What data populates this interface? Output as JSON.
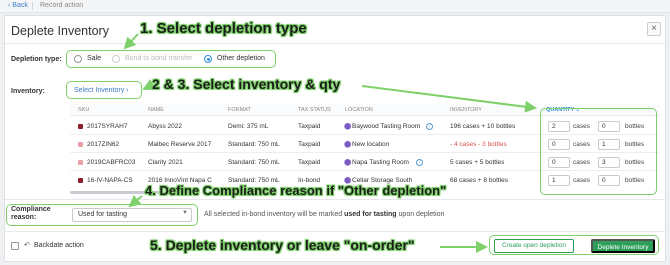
{
  "topbar": {
    "back_label": "‹ Back",
    "record_action": "Record action"
  },
  "page": {
    "title": "Deplete Inventory",
    "close_icon": "close-icon"
  },
  "depletion_type": {
    "label": "Depletion type:",
    "options": [
      "Sale",
      "Bond to bond transfer",
      "Other depletion"
    ],
    "selected": "Other depletion"
  },
  "inventory": {
    "label": "Inventory:",
    "select_link": "Select Inventory ›"
  },
  "table": {
    "headers": {
      "sku": "SKU",
      "name": "NAME",
      "format": "FORMAT",
      "tax_status": "TAX STATUS",
      "location": "LOCATION",
      "inventory": "INVENTORY",
      "quantity": "QUANTITY ⌄"
    },
    "rows": [
      {
        "sku": "2017SYRAH7",
        "name": "Abyss 2022",
        "format": "Demi: 375 mL",
        "tax": "Taxpaid",
        "location": "Baywood Tasting Room",
        "inventory": "196 cases + 10 bottles",
        "cases": "2",
        "bottles": "0",
        "color": "#8b1e2d"
      },
      {
        "sku": "2017ZIN62",
        "name": "Malbec Reserve 2017",
        "format": "Standard: 750 mL",
        "tax": "Taxpaid",
        "location": "New location",
        "inventory": "- 4 cases - 3 bottles",
        "cases": "0",
        "bottles": "1",
        "color": "#e8a0a8"
      },
      {
        "sku": "2019CABFRC03",
        "name": "Clarity 2021",
        "format": "Standard: 750 mL",
        "tax": "Taxpaid",
        "location": "Napa Tasting Room",
        "inventory": "5 cases + 5 bottles",
        "cases": "0",
        "bottles": "3",
        "color": "#e8a0a8"
      },
      {
        "sku": "16-IV-NAPA-CS",
        "name": "2016 InnoVint Napa C",
        "format": "Standard: 750 mL",
        "tax": "In-bond",
        "location": "Cellar Storage South",
        "inventory": "68 cases + 8 bottles",
        "cases": "1",
        "bottles": "0",
        "color": "#8b1e2d"
      }
    ],
    "unit_cases": "cases",
    "unit_bottles": "bottles"
  },
  "compliance": {
    "label_line1": "Compliance",
    "label_line2": "reason:",
    "selected": "Used for tasting",
    "note_prefix": "All selected in-bond inventory will be marked ",
    "note_bold": "used for tasting",
    "note_suffix": " upon depletion"
  },
  "footer": {
    "backdate_label": "Backdate action",
    "create_open_label": "Create open depletion",
    "deplete_label": "Deplete Inventory"
  },
  "annotations": {
    "step1": "1. Select depletion type",
    "step2": "2 & 3. Select inventory & qty",
    "step4": "4. Define Compliance reason if \"Other depletion\"",
    "step5": "5. Deplete inventory or leave \"on-order\""
  },
  "colors": {
    "accent": "#2e9e5b",
    "link": "#3a7bc8",
    "highlight": "#7ed16a",
    "error": "#d9534f"
  }
}
